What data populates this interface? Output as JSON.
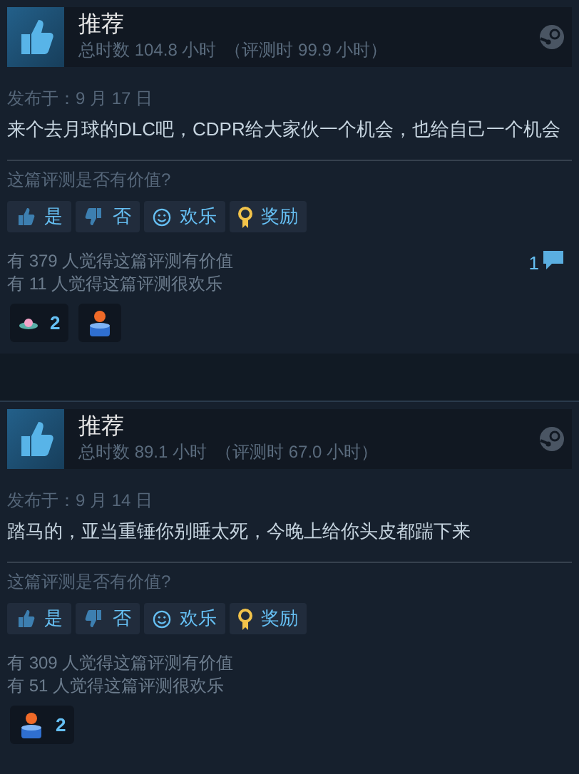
{
  "reviews": [
    {
      "verdict": "推荐",
      "hours": "总时数 104.8 小时",
      "review_hours": "（评测时 99.9 小时）",
      "date": "发布于：9 月 17 日",
      "body": "来个去月球的DLC吧，CDPR给大家伙一个机会，也给自己一个机会",
      "question": "这篇评测是否有价值?",
      "buttons": [
        {
          "kind": "yes",
          "label": "是"
        },
        {
          "kind": "no",
          "label": "否"
        },
        {
          "kind": "funny",
          "label": "欢乐"
        },
        {
          "kind": "award",
          "label": "奖励"
        }
      ],
      "helpful": "有 379 人觉得这篇评测有价值",
      "funny": "有 11 人觉得这篇评测很欢乐",
      "comments": "1",
      "awards": [
        {
          "kind": "ufo",
          "count": "2"
        },
        {
          "kind": "gift"
        }
      ]
    },
    {
      "verdict": "推荐",
      "hours": "总时数 89.1 小时",
      "review_hours": "（评测时 67.0 小时）",
      "date": "发布于：9 月 14 日",
      "body": "踏马的，亚当重锤你别睡太死，今晚上给你头皮都踹下来",
      "question": "这篇评测是否有价值?",
      "buttons": [
        {
          "kind": "yes",
          "label": "是"
        },
        {
          "kind": "no",
          "label": "否"
        },
        {
          "kind": "funny",
          "label": "欢乐"
        },
        {
          "kind": "award",
          "label": "奖励"
        }
      ],
      "helpful": "有 309 人觉得这篇评测有价值",
      "funny": "有 51 人觉得这篇评测很欢乐",
      "awards": [
        {
          "kind": "gift",
          "count": "2"
        }
      ]
    }
  ]
}
